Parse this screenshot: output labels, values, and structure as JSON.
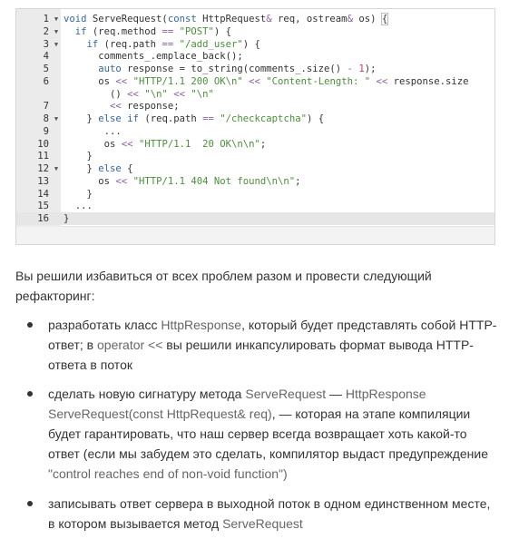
{
  "code": {
    "lines": [
      {
        "n": "1",
        "fold": true,
        "text": "void ServeRequest(const HttpRequest& req, ostream& os) {"
      },
      {
        "n": "2",
        "fold": true,
        "text": "  if (req.method == \"POST\") {"
      },
      {
        "n": "3",
        "fold": true,
        "text": "    if (req.path == \"/add_user\") {"
      },
      {
        "n": "4",
        "fold": false,
        "text": "      comments_.emplace_back();"
      },
      {
        "n": "5",
        "fold": false,
        "text": "      auto response = to_string(comments_.size() - 1);"
      },
      {
        "n": "6",
        "fold": false,
        "text": "      os << \"HTTP/1.1 200 OK\\n\" << \"Content-Length: \" << response.size"
      },
      {
        "n": "",
        "fold": false,
        "text": "        () << \"\\n\" << \"\\n\""
      },
      {
        "n": "7",
        "fold": false,
        "text": "        << response;"
      },
      {
        "n": "8",
        "fold": true,
        "text": "    } else if (req.path == \"/checkcaptcha\") {"
      },
      {
        "n": "9",
        "fold": false,
        "text": "       ..."
      },
      {
        "n": "10",
        "fold": false,
        "text": "       os << \"HTTP/1.1  20 OK\\n\\n\";"
      },
      {
        "n": "11",
        "fold": false,
        "text": "    }"
      },
      {
        "n": "12",
        "fold": true,
        "text": "    } else {"
      },
      {
        "n": "13",
        "fold": false,
        "text": "      os << \"HTTP/1.1 404 Not found\\n\\n\";"
      },
      {
        "n": "14",
        "fold": false,
        "text": "    }"
      },
      {
        "n": "15",
        "fold": false,
        "text": "  ..."
      },
      {
        "n": "16",
        "fold": false,
        "text": "}"
      }
    ],
    "active_line": "16"
  },
  "intro": {
    "line1": "Вы решили избавиться от всех проблем разом и провести следующий",
    "line2": "рефакторинг:"
  },
  "bullets": [
    {
      "lines": [
        [
          {
            "t": "разработать класс "
          },
          {
            "t": "HttpResponse",
            "code": true
          },
          {
            "t": ", который будет представлять собой HTTP-"
          }
        ],
        [
          {
            "t": "ответ; в "
          },
          {
            "t": "operator <<",
            "code": true
          },
          {
            "t": " вы решили инкапсулировать формат вывода HTTP-"
          }
        ],
        [
          {
            "t": "ответа в поток"
          }
        ]
      ]
    },
    {
      "lines": [
        [
          {
            "t": "сделать новую сигнатуру метода "
          },
          {
            "t": "ServeRequest",
            "code": true
          },
          {
            "t": " — "
          },
          {
            "t": "HttpResponse",
            "code": true
          }
        ],
        [
          {
            "t": "ServeRequest(const HttpRequest& req)",
            "code": true
          },
          {
            "t": ", — которая на этапе компиляции"
          }
        ],
        [
          {
            "t": "будет гарантировать, что наш сервер всегда возвращает хоть какой-то"
          }
        ],
        [
          {
            "t": "ответ (если мы забудем это сделать, компилятор выдаст предупреждение"
          }
        ],
        [
          {
            "t": "\"control reaches end of non-void function\")",
            "code": true
          }
        ]
      ]
    },
    {
      "lines": [
        [
          {
            "t": "записывать ответ сервера в выходной поток в одном единственном месте,"
          }
        ],
        [
          {
            "t": "в котором вызывается метод "
          },
          {
            "t": "ServeRequest",
            "code": true
          }
        ]
      ]
    }
  ]
}
